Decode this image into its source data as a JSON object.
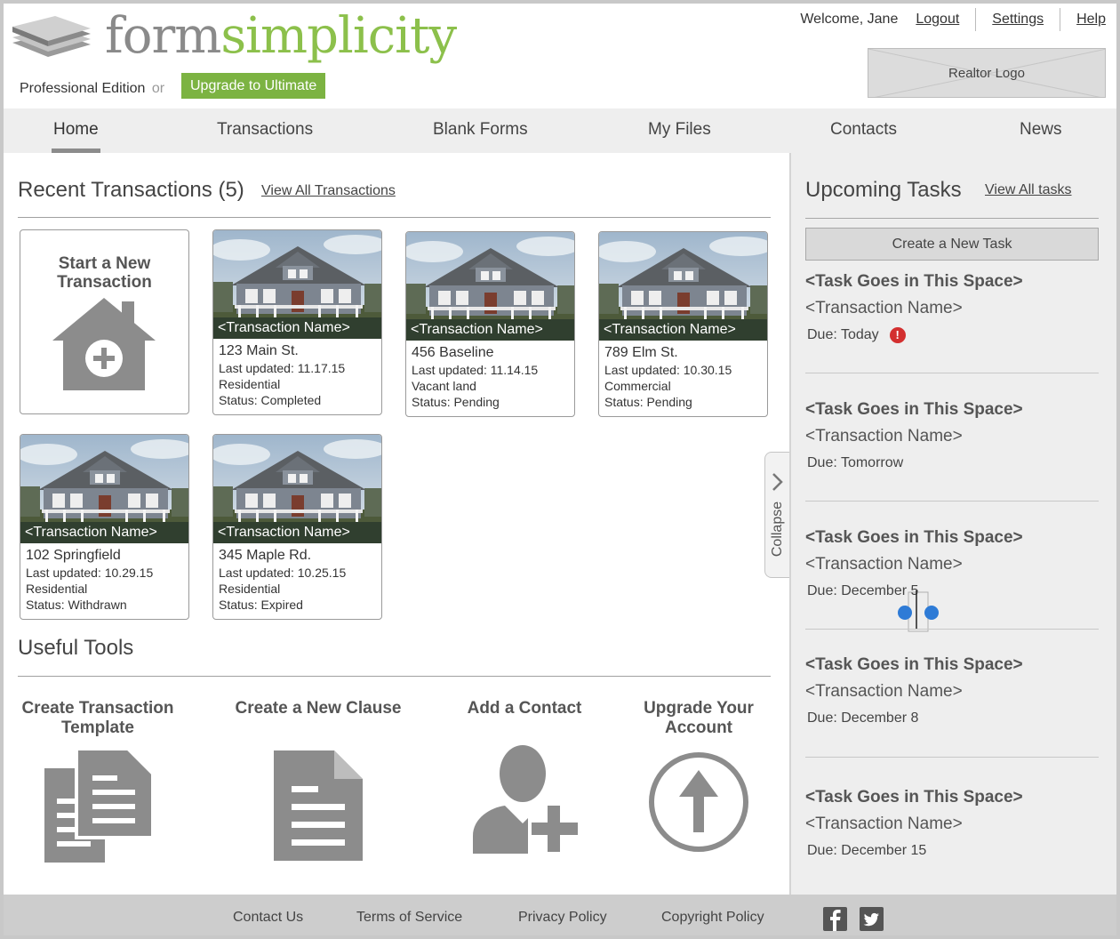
{
  "brand": {
    "name_part1": "form",
    "name_part2": "simplicity",
    "edition": "Professional Edition",
    "edition_or": "or",
    "upgrade_label": "Upgrade to Ultimate",
    "accent_color": "#7cb342"
  },
  "user_bar": {
    "welcome": "Welcome, Jane",
    "logout": "Logout",
    "settings": "Settings",
    "help": "Help"
  },
  "realtor_logo": "Realtor Logo",
  "nav": {
    "items": [
      "Home",
      "Transactions",
      "Blank Forms",
      "My Files",
      "Contacts",
      "News"
    ],
    "active": "Home"
  },
  "recent": {
    "title": "Recent Transactions (5)",
    "view_all": "View All Transactions",
    "new_transaction": "Start a New Transaction",
    "cards": [
      {
        "name": "<Transaction Name>",
        "address": "123 Main St.",
        "updated": "Last updated: 11.17.15",
        "type": "Residential",
        "status": "Status: Completed"
      },
      {
        "name": "<Transaction Name>",
        "address": "456 Baseline",
        "updated": "Last updated: 11.14.15",
        "type": "Vacant land",
        "status": "Status: Pending"
      },
      {
        "name": "<Transaction Name>",
        "address": "789 Elm St.",
        "updated": "Last updated: 10.30.15",
        "type": "Commercial",
        "status": "Status: Pending"
      },
      {
        "name": "<Transaction Name>",
        "address": "102 Springfield",
        "updated": "Last updated: 10.29.15",
        "type": "Residential",
        "status": "Status: Withdrawn"
      },
      {
        "name": "<Transaction Name>",
        "address": "345 Maple Rd.",
        "updated": "Last updated: 10.25.15",
        "type": "Residential",
        "status": "Status: Expired"
      }
    ]
  },
  "tools": {
    "title": "Useful Tools",
    "items": [
      {
        "label": "Create Transaction Template",
        "icon": "documents-icon"
      },
      {
        "label": "Create a New Clause",
        "icon": "document-icon"
      },
      {
        "label": "Add a Contact",
        "icon": "add-user-icon"
      },
      {
        "label": "Upgrade Your Account",
        "icon": "upgrade-arrow-icon"
      }
    ]
  },
  "collapse_label": "Collapse",
  "tasks": {
    "title": "Upcoming Tasks",
    "view_all": "View All tasks",
    "create": "Create a New Task",
    "items": [
      {
        "title": "<Task Goes in This Space>",
        "transaction": "<Transaction Name>",
        "due": "Due: Today",
        "overdue": true
      },
      {
        "title": "<Task Goes in This Space>",
        "transaction": "<Transaction Name>",
        "due": "Due: Tomorrow",
        "overdue": false
      },
      {
        "title": "<Task Goes in This Space>",
        "transaction": "<Transaction Name>",
        "due": "Due: December 5",
        "overdue": false
      },
      {
        "title": "<Task Goes in This Space>",
        "transaction": "<Transaction Name>",
        "due": "Due: December 8",
        "overdue": false
      },
      {
        "title": "<Task Goes in This Space>",
        "transaction": "<Transaction Name>",
        "due": "Due: December 15",
        "overdue": false
      }
    ],
    "alert_color": "#d32f2f"
  },
  "footer": {
    "links": [
      "Contact Us",
      "Terms of Service",
      "Privacy Policy",
      "Copyright Policy"
    ],
    "social": [
      "facebook-icon",
      "twitter-icon"
    ]
  }
}
